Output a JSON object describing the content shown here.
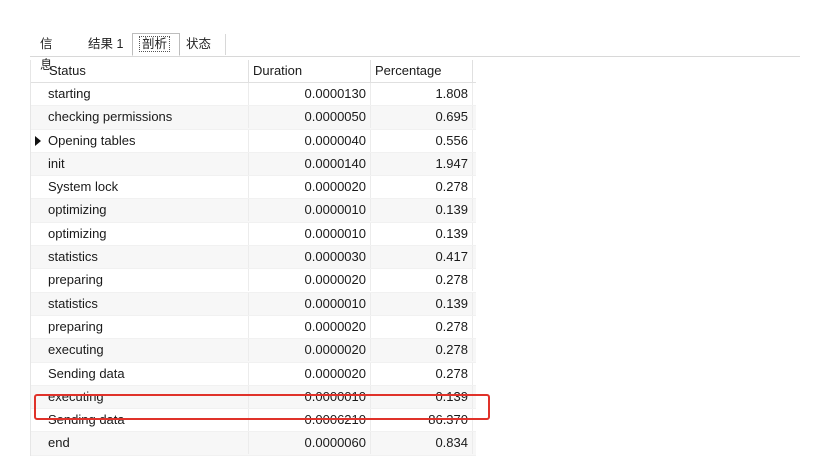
{
  "tabs": [
    {
      "label": "信息"
    },
    {
      "label": "结果 1"
    },
    {
      "label": "剖析"
    },
    {
      "label": "状态"
    }
  ],
  "active_tab": 2,
  "columns": [
    "Status",
    "Duration",
    "Percentage"
  ],
  "rows": [
    {
      "status": "starting",
      "duration": "0.0000130",
      "percentage": "1.808"
    },
    {
      "status": "checking permissions",
      "duration": "0.0000050",
      "percentage": "0.695"
    },
    {
      "status": "Opening tables",
      "duration": "0.0000040",
      "percentage": "0.556"
    },
    {
      "status": "init",
      "duration": "0.0000140",
      "percentage": "1.947"
    },
    {
      "status": "System lock",
      "duration": "0.0000020",
      "percentage": "0.278"
    },
    {
      "status": "optimizing",
      "duration": "0.0000010",
      "percentage": "0.139"
    },
    {
      "status": "optimizing",
      "duration": "0.0000010",
      "percentage": "0.139"
    },
    {
      "status": "statistics",
      "duration": "0.0000030",
      "percentage": "0.417"
    },
    {
      "status": "preparing",
      "duration": "0.0000020",
      "percentage": "0.278"
    },
    {
      "status": "statistics",
      "duration": "0.0000010",
      "percentage": "0.139"
    },
    {
      "status": "preparing",
      "duration": "0.0000020",
      "percentage": "0.278"
    },
    {
      "status": "executing",
      "duration": "0.0000020",
      "percentage": "0.278"
    },
    {
      "status": "Sending data",
      "duration": "0.0000020",
      "percentage": "0.278"
    },
    {
      "status": "executing",
      "duration": "0.0000010",
      "percentage": "0.139"
    },
    {
      "status": "Sending data",
      "duration": "0.0006210",
      "percentage": "86.370"
    },
    {
      "status": "end",
      "duration": "0.0000060",
      "percentage": "0.834"
    }
  ],
  "current_row_index": 2,
  "highlighted_row_index": 14,
  "colors": {
    "highlight": "#e0322a"
  }
}
